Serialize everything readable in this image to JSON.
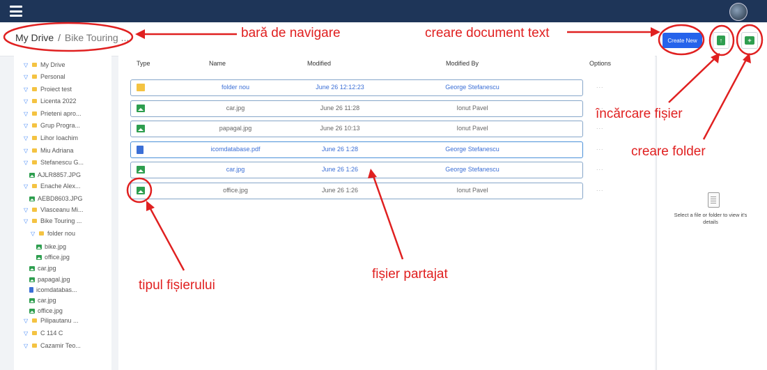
{
  "topbar": {
    "menu_icon": "hamburger-icon",
    "avatar_icon": "user-avatar"
  },
  "breadcrumb": {
    "root": "My Drive",
    "separator": "/",
    "current": "Bike Touring ..."
  },
  "toolbar": {
    "create_new": "Create New",
    "upload_icon": "upload-file-icon",
    "new_folder_icon": "add-folder-icon"
  },
  "sidebar": {
    "items": [
      {
        "label": "My Drive",
        "kind": "folder",
        "expanded": true
      },
      {
        "label": "Personal",
        "kind": "folder"
      },
      {
        "label": "Proiect test",
        "kind": "folder"
      },
      {
        "label": "Licenta 2022",
        "kind": "folder"
      },
      {
        "label": "Prieteni apro...",
        "kind": "folder"
      },
      {
        "label": "Grup Progra...",
        "kind": "folder"
      },
      {
        "label": "Lihor Ioachim",
        "kind": "folder"
      },
      {
        "label": "Miu Adriana",
        "kind": "folder"
      },
      {
        "label": "Stefanescu G...",
        "kind": "folder"
      },
      {
        "label": "AJLR8857.JPG",
        "kind": "image"
      },
      {
        "label": "Enache Alex...",
        "kind": "folder"
      },
      {
        "label": "AEBD8603.JPG",
        "kind": "image"
      },
      {
        "label": "Vlasceanu Mi...",
        "kind": "folder"
      },
      {
        "label": "Bike Touring ...",
        "kind": "folder"
      },
      {
        "label": "folder nou",
        "kind": "folder"
      },
      {
        "label": "bike.jpg",
        "kind": "image"
      },
      {
        "label": "office.jpg",
        "kind": "image"
      },
      {
        "label": "car.jpg",
        "kind": "image"
      },
      {
        "label": "papagal.jpg",
        "kind": "image"
      },
      {
        "label": "icomdatabas...",
        "kind": "pdf"
      },
      {
        "label": "car.jpg",
        "kind": "image"
      },
      {
        "label": "office.jpg",
        "kind": "image"
      },
      {
        "label": "Pilipautanu ...",
        "kind": "folder"
      },
      {
        "label": "C 114 C",
        "kind": "folder"
      },
      {
        "label": "Cazamir Teo...",
        "kind": "folder"
      }
    ]
  },
  "table": {
    "headers": {
      "type": "Type",
      "name": "Name",
      "modified": "Modified",
      "modified_by": "Modified By",
      "options": "Options"
    },
    "rows": [
      {
        "type": "folder",
        "name": "folder nou",
        "modified": "June 26 12:12:23",
        "by": "George Stefanescu",
        "shared": true
      },
      {
        "type": "image",
        "name": "car.jpg",
        "modified": "June 26 11:28",
        "by": "Ionut Pavel",
        "shared": false
      },
      {
        "type": "image",
        "name": "papagal.jpg",
        "modified": "June 26 10:13",
        "by": "Ionut Pavel",
        "shared": false
      },
      {
        "type": "pdf",
        "name": "icomdatabase.pdf",
        "modified": "June 26 1:28",
        "by": "George Stefanescu",
        "shared": true
      },
      {
        "type": "image",
        "name": "car.jpg",
        "modified": "June 26 1:26",
        "by": "George Stefanescu",
        "shared": true
      },
      {
        "type": "image",
        "name": "office.jpg",
        "modified": "June 26 1:26",
        "by": "Ionut Pavel",
        "shared": false
      }
    ],
    "options_label": "..."
  },
  "details": {
    "placeholder": "Select a file or folder to view it's details"
  },
  "annotations": {
    "nav": "bară de navigare",
    "create_doc": "creare document text",
    "upload": "încărcare fișier",
    "new_folder": "creare folder",
    "shared": "fișier partajat",
    "file_type": "tipul fișierului"
  },
  "colors": {
    "topbar": "#1e3558",
    "accent": "#2563eb",
    "annotation": "#e02020",
    "folder": "#f4c342",
    "image": "#2e9e4f"
  }
}
